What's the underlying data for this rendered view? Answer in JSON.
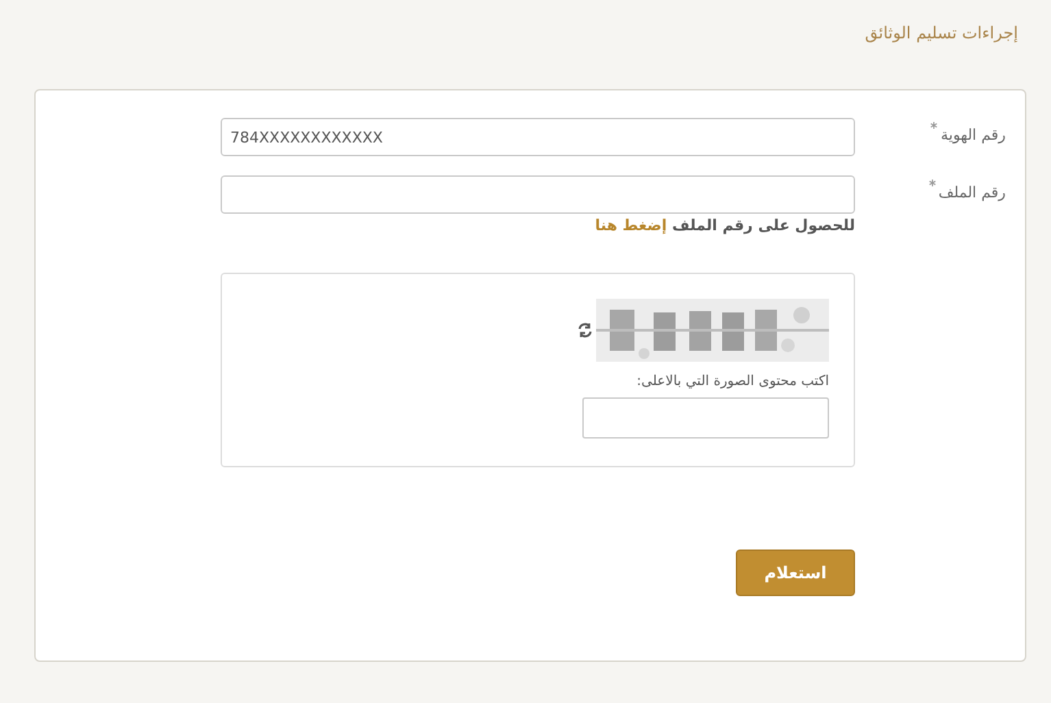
{
  "page_title": "إجراءات تسليم الوثائق",
  "fields": [
    {
      "label": "رقم الهوية",
      "required": true,
      "value": "784XXXXXXXXXXXX"
    },
    {
      "label": "رقم الملف",
      "required": true
    }
  ],
  "file_hint": {
    "text": "للحصول على رقم الملف",
    "link": "إضغط هنا"
  },
  "captcha": {
    "kind": "picture",
    "prompt": "اكتب محتوى الصورة التي بالاعلى:"
  },
  "submit_button": "استعلام"
}
